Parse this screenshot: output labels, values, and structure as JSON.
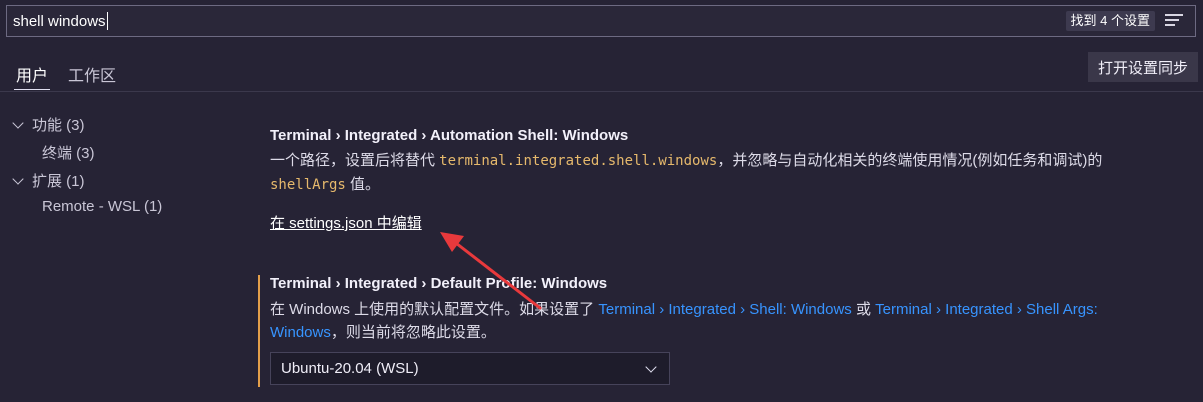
{
  "search": {
    "value": "shell windows",
    "result_count": "找到 4 个设置",
    "filter_icon": "filter-list-icon"
  },
  "tabs": [
    {
      "label": "用户"
    },
    {
      "label": "工作区"
    }
  ],
  "sync_button": {
    "label": "打开设置同步"
  },
  "toc": [
    {
      "label": "功能 (3)",
      "expanded": true
    },
    {
      "label": "终端 (3)"
    },
    {
      "label": "扩展 (1)",
      "expanded": true
    },
    {
      "label": "Remote - WSL (1)"
    }
  ],
  "settings": [
    {
      "title": "Terminal › Integrated › Automation Shell: Windows",
      "desc_pre": "一个路径，设置后将替代 ",
      "desc_code1": "terminal.integrated.shell.windows",
      "desc_mid": "，并忽略与自动化相关的终端使用情况(例如任务和调试)的 ",
      "desc_code2": "shellArgs",
      "desc_post": " 值。",
      "edit_link": "在 settings.json 中编辑"
    },
    {
      "title": "Terminal › Integrated › Default Profile: Windows",
      "desc_pre": "在 Windows 上使用的默认配置文件。如果设置了 ",
      "desc_link1": "Terminal › Integrated › Shell: Windows",
      "desc_mid": " 或 ",
      "desc_link2": "Terminal › Integrated › Shell Args: Windows",
      "desc_post": "，则当前将忽略此设置。",
      "selected_value": "Ubuntu-20.04 (WSL)"
    }
  ],
  "colors": {
    "accent": "#e39f4a",
    "link": "#3794ff",
    "annotation_arrow": "#e8393c"
  }
}
